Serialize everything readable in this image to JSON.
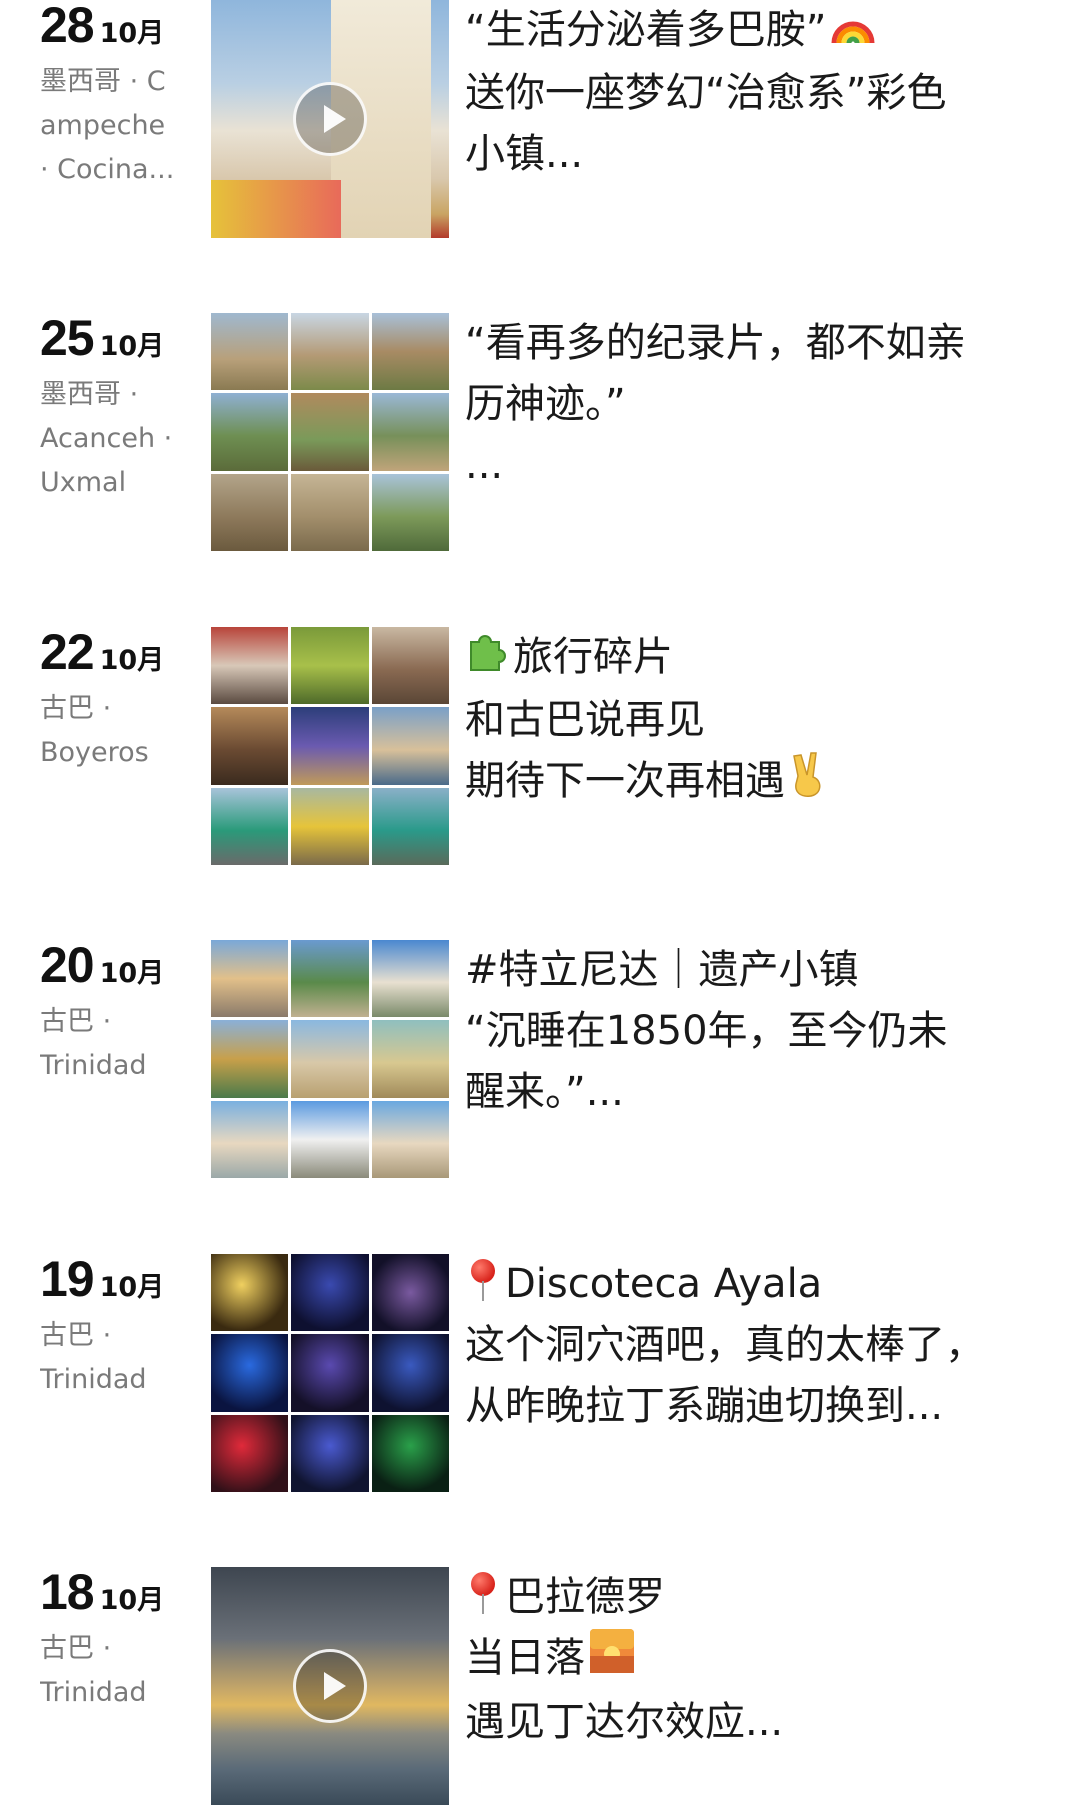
{
  "posts": [
    {
      "day": "28",
      "month": "10月",
      "location_lines": [
        "墨西哥 · C",
        "ampeche",
        "· Cocina..."
      ],
      "media": "video",
      "text_lines": [
        "“生活分泌着多巴胺”",
        "送你一座梦幻“治愈系”彩色",
        "小镇..."
      ],
      "emoji": "rainbow-icon"
    },
    {
      "day": "25",
      "month": "10月",
      "location_lines": [
        "墨西哥 ·",
        "Acanceh ·",
        "Uxmal"
      ],
      "media": "grid",
      "text_lines": [
        "“看再多的纪录片，都不如亲",
        "历神迹。”",
        "..."
      ]
    },
    {
      "day": "22",
      "month": "10月",
      "location_lines": [
        "古巴 ·",
        "Boyeros"
      ],
      "media": "grid",
      "text_lines": [
        "旅行碎片",
        "和古巴说再见",
        "期待下一次再相遇"
      ]
    },
    {
      "day": "20",
      "month": "10月",
      "location_lines": [
        "古巴 ·",
        "Trinidad"
      ],
      "media": "grid",
      "text_lines": [
        "#特立尼达｜遗产小镇",
        "“沉睡在1850年，至今仍未",
        "醒来。”..."
      ]
    },
    {
      "day": "19",
      "month": "10月",
      "location_lines": [
        "古巴 ·",
        "Trinidad"
      ],
      "media": "grid",
      "text_lines": [
        "Discoteca Ayala",
        "这个洞穴酒吧，真的太棒了，",
        "从昨晚拉丁系蹦迪切换到..."
      ]
    },
    {
      "day": "18",
      "month": "10月",
      "location_lines": [
        "古巴 ·",
        "Trinidad"
      ],
      "media": "video",
      "text_lines": [
        "巴拉德罗",
        "当日落",
        "遇见丁达尔效应..."
      ]
    }
  ],
  "icons": {
    "play": "play-icon",
    "pin": "location-pin-icon",
    "puzzle": "puzzle-icon",
    "victory": "victory-hand-icon",
    "sunset": "sunset-icon",
    "rainbow": "rainbow-icon"
  },
  "colors": {
    "text": "#1a1a1a",
    "location": "#7a7a7a",
    "background": "#ffffff"
  }
}
